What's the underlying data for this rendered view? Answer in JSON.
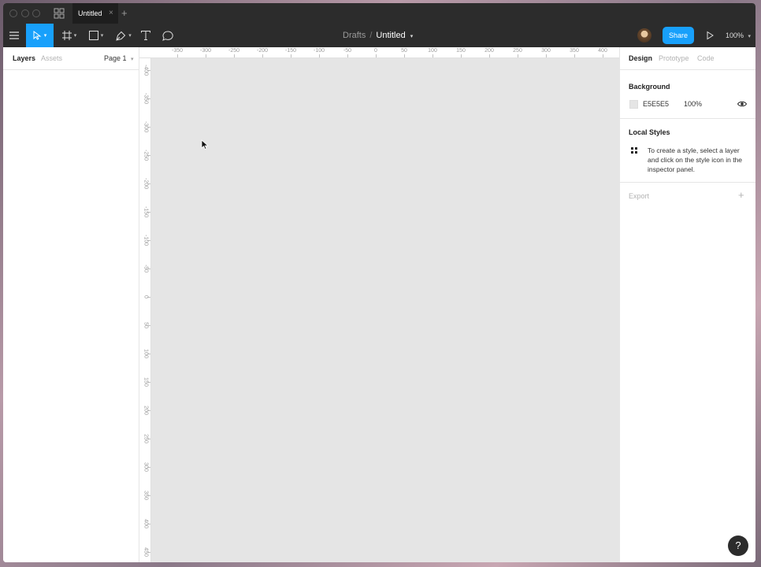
{
  "titlebar": {
    "tab_title": "Untitled",
    "tab_close": "×",
    "new_tab": "+"
  },
  "toolbar": {
    "breadcrumb_folder": "Drafts",
    "breadcrumb_separator": "/",
    "file_name": "Untitled",
    "share_label": "Share",
    "zoom_level": "100%",
    "active_tool": "move",
    "accent_color": "#18a0fb"
  },
  "left_panel": {
    "tabs": [
      "Layers",
      "Assets"
    ],
    "active_tab": "Layers",
    "page_selector": "Page 1"
  },
  "rulers": {
    "horizontal": [
      "-350",
      "-300",
      "-250",
      "-200",
      "-150",
      "-100",
      "-50",
      "0",
      "50",
      "100",
      "150",
      "200",
      "250",
      "300",
      "350",
      "400"
    ],
    "vertical": [
      "-400",
      "-350",
      "-300",
      "-250",
      "-200",
      "-150",
      "-100",
      "-50",
      "0",
      "50",
      "100",
      "150",
      "200",
      "250",
      "300",
      "350",
      "400",
      "450"
    ]
  },
  "canvas": {
    "background_color": "#E5E5E5"
  },
  "right_panel": {
    "tabs": [
      "Design",
      "Prototype",
      "Code"
    ],
    "active_tab": "Design",
    "background": {
      "title": "Background",
      "hex": "E5E5E5",
      "opacity": "100%"
    },
    "local_styles": {
      "title": "Local Styles",
      "message": "To create a style, select a layer and click on the style icon in the inspector panel."
    },
    "export": {
      "title": "Export"
    }
  },
  "help": {
    "label": "?"
  }
}
